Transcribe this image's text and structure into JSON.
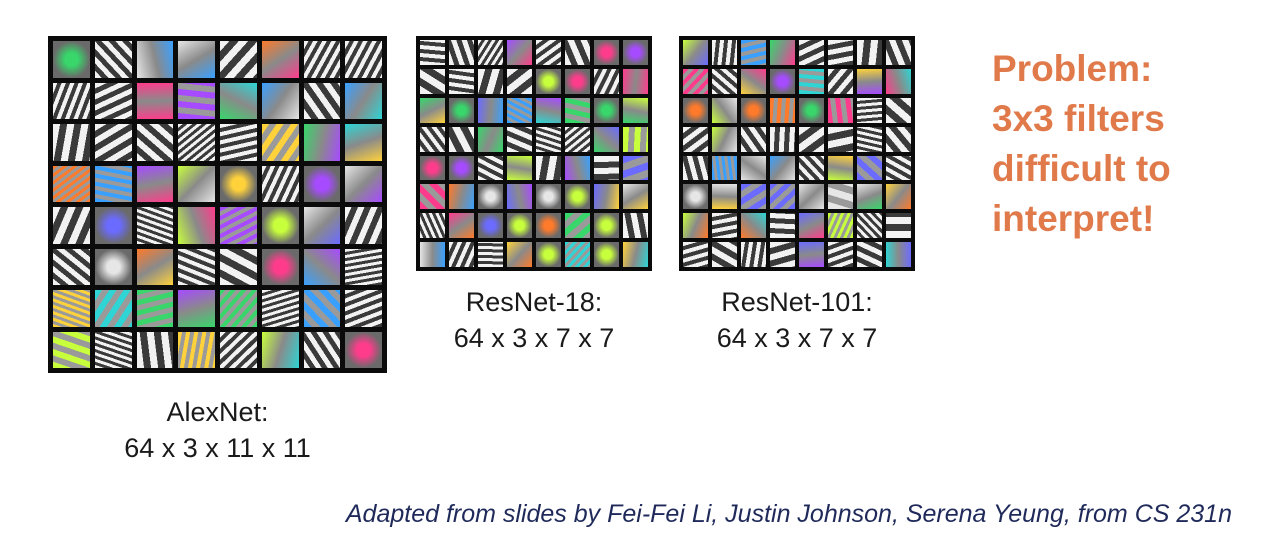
{
  "colors": {
    "problem_text": "#e07a4a",
    "credit_text": "#1f2a5a",
    "caption_text": "#1a1a1a",
    "grid_background": "#0b0b0b"
  },
  "filter_grids": [
    {
      "name": "alexnet",
      "rows": 8,
      "cols": 8,
      "caption_lines": [
        "AlexNet:",
        "64 x 3 x 11 x 11"
      ]
    },
    {
      "name": "resnet18",
      "rows": 8,
      "cols": 8,
      "caption_lines": [
        "ResNet-18:",
        "64 x 3 x 7 x 7"
      ]
    },
    {
      "name": "resnet101",
      "rows": 8,
      "cols": 8,
      "caption_lines": [
        "ResNet-101:",
        "64 x 3 x 7 x 7"
      ]
    }
  ],
  "problem": {
    "lines": [
      "Problem:",
      "3x3 filters",
      "difficult to",
      "interpret!"
    ]
  },
  "credit": "Adapted from slides by Fei-Fei Li, Justin Johnson, Serena Yeung, from CS 231n"
}
